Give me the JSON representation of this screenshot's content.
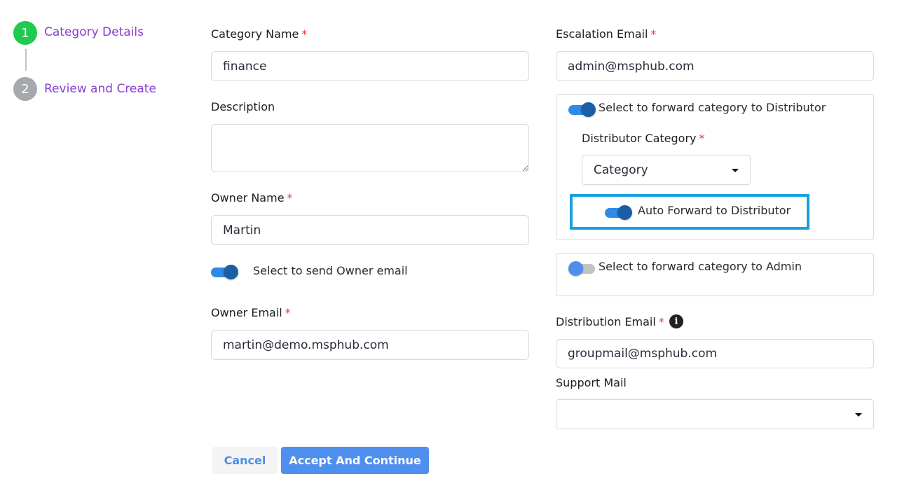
{
  "stepper": {
    "steps": [
      {
        "number": "1",
        "label": "Category Details",
        "state": "active"
      },
      {
        "number": "2",
        "label": "Review and Create",
        "state": "inactive"
      }
    ]
  },
  "form": {
    "category_name": {
      "label": "Category Name",
      "required": "*",
      "value": "finance"
    },
    "description": {
      "label": "Description",
      "value": ""
    },
    "owner_name": {
      "label": "Owner Name",
      "required": "*",
      "value": "Martin"
    },
    "send_owner_email": {
      "label": "Select to send Owner email",
      "checked": true
    },
    "owner_email": {
      "label": "Owner Email",
      "required": "*",
      "value": "martin@demo.msphub.com"
    },
    "escalation_email": {
      "label": "Escalation Email",
      "required": "*",
      "value": "admin@msphub.com"
    },
    "forward_distributor": {
      "label": "Select to forward category to Distributor",
      "checked": true
    },
    "distributor_category": {
      "label": "Distributor Category",
      "required": "*",
      "selected": "Category"
    },
    "auto_forward": {
      "label": "Auto Forward to Distributor",
      "checked": true
    },
    "forward_admin": {
      "label": "Select to forward category to Admin",
      "checked": false
    },
    "distribution_email": {
      "label": "Distribution Email",
      "required": "*",
      "info_icon": "info-icon",
      "value": "groupmail@msphub.com"
    },
    "support_mail": {
      "label": "Support Mail",
      "selected": ""
    }
  },
  "buttons": {
    "cancel": "Cancel",
    "accept": "Accept And Continue"
  },
  "colors": {
    "step_active": "#1ecb4f",
    "step_inactive": "#a6a8ad",
    "step_label": "#8a3fd1",
    "required": "#e53935",
    "toggle_on_track": "#2d8ae6",
    "toggle_on_thumb": "#1c5ea3",
    "highlight": "#1aa0e0",
    "primary_button": "#4f8fee"
  }
}
